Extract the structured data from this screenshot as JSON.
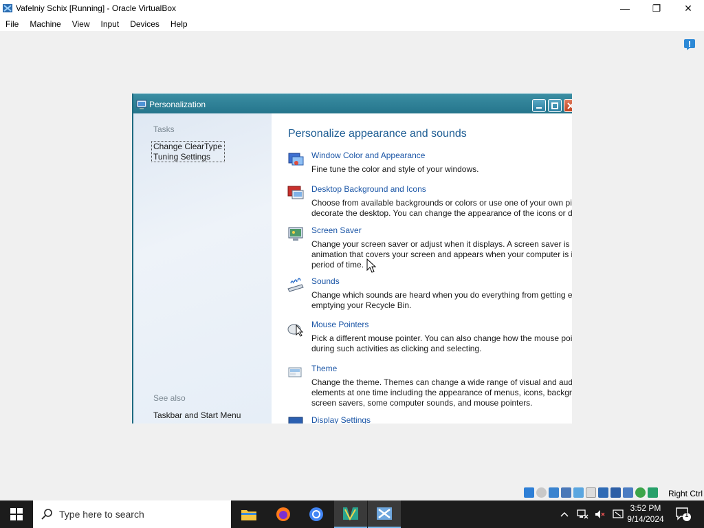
{
  "host": {
    "title": "Vafelniy  Schix [Running] - Oracle VirtualBox",
    "controls": {
      "minimize": "—",
      "maximize": "❐",
      "close": "✕"
    },
    "menu": [
      "File",
      "Machine",
      "View",
      "Input",
      "Devices",
      "Help"
    ],
    "status_right": "Right Ctrl"
  },
  "window": {
    "title": "Personalization",
    "sidebar": {
      "tasks_heading": "Tasks",
      "task_link_line1": "Change ClearType",
      "task_link_line2": "Tuning Settings",
      "see_also_heading": "See also",
      "see_also_link": "Taskbar and Start Menu"
    },
    "content": {
      "heading": "Personalize appearance and sounds",
      "items": [
        {
          "icon": "window-color-icon",
          "link": "Window Color and Appearance",
          "desc": [
            "Fine tune the color and style of your windows."
          ]
        },
        {
          "icon": "desktop-background-icon",
          "link": "Desktop Background and Icons",
          "desc": [
            "Choose from available backgrounds or colors or use one of your own pic",
            "decorate the desktop. You can change the appearance of the icons or dis"
          ]
        },
        {
          "icon": "screen-saver-icon",
          "link": "Screen Saver",
          "desc": [
            "Change your screen saver or adjust when it displays. A screen saver is a p",
            "animation that covers your screen and appears when your computer is id",
            "period of time."
          ]
        },
        {
          "icon": "sounds-icon",
          "link": "Sounds",
          "desc": [
            "Change which sounds are heard when you do everything from getting e",
            "emptying your Recycle Bin."
          ]
        },
        {
          "icon": "mouse-pointers-icon",
          "link": "Mouse Pointers",
          "desc": [
            "Pick a different mouse pointer. You can also change how the mouse poi",
            "during such activities as clicking and selecting."
          ]
        },
        {
          "icon": "theme-icon",
          "link": "Theme",
          "desc": [
            "Change the theme. Themes can change a wide range of visual and audit",
            "elements at one time including the appearance of menus, icons, backgro",
            "screen savers, some computer sounds, and mouse pointers."
          ]
        },
        {
          "icon": "display-settings-icon",
          "link": "Display Settings",
          "desc": []
        }
      ]
    }
  },
  "taskbar": {
    "search_placeholder": "Type here to search",
    "apps": [
      "file-explorer-icon",
      "firefox-icon",
      "chrome-icon",
      "virtualbox-manager-icon",
      "virtualbox-vm-icon"
    ],
    "time": "3:52 PM",
    "date": "9/14/2024",
    "notification_count": "1"
  },
  "colors": {
    "link": "#1a55a6",
    "heading": "#1c5c93",
    "titlebar": "#25758c",
    "taskbar": "#1c1c1c"
  }
}
